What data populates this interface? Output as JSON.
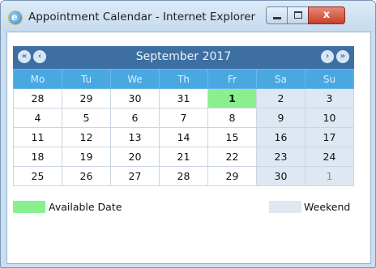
{
  "window": {
    "title": "Appointment Calendar - Internet Explorer",
    "close_glyph": "x"
  },
  "calendar": {
    "month_label": "September 2017",
    "nav": {
      "prev_year": "«",
      "prev_month": "‹",
      "next_month": "›",
      "next_year": "»"
    },
    "weekdays": [
      "Mo",
      "Tu",
      "We",
      "Th",
      "Fr",
      "Sa",
      "Su"
    ],
    "weeks": [
      [
        {
          "d": "28",
          "other": true
        },
        {
          "d": "29",
          "other": true
        },
        {
          "d": "30",
          "other": true
        },
        {
          "d": "31",
          "other": true
        },
        {
          "d": "1",
          "available": true
        },
        {
          "d": "2",
          "weekend": true
        },
        {
          "d": "3",
          "weekend": true
        }
      ],
      [
        {
          "d": "4"
        },
        {
          "d": "5"
        },
        {
          "d": "6"
        },
        {
          "d": "7"
        },
        {
          "d": "8"
        },
        {
          "d": "9",
          "weekend": true
        },
        {
          "d": "10",
          "weekend": true
        }
      ],
      [
        {
          "d": "11"
        },
        {
          "d": "12"
        },
        {
          "d": "13"
        },
        {
          "d": "14"
        },
        {
          "d": "15"
        },
        {
          "d": "16",
          "weekend": true
        },
        {
          "d": "17",
          "weekend": true
        }
      ],
      [
        {
          "d": "18"
        },
        {
          "d": "19"
        },
        {
          "d": "20"
        },
        {
          "d": "21"
        },
        {
          "d": "22"
        },
        {
          "d": "23",
          "weekend": true
        },
        {
          "d": "24",
          "weekend": true
        }
      ],
      [
        {
          "d": "25"
        },
        {
          "d": "26"
        },
        {
          "d": "27"
        },
        {
          "d": "28"
        },
        {
          "d": "29"
        },
        {
          "d": "30",
          "weekend": true
        },
        {
          "d": "1",
          "weekend": true,
          "other": true
        }
      ]
    ]
  },
  "legend": {
    "available_label": "Available Date",
    "weekend_label": "Weekend"
  },
  "colors": {
    "header_bg": "#3e6fa3",
    "weekday_bg": "#4aa8e1",
    "available": "#8af08f",
    "weekend": "#dde8f2"
  }
}
